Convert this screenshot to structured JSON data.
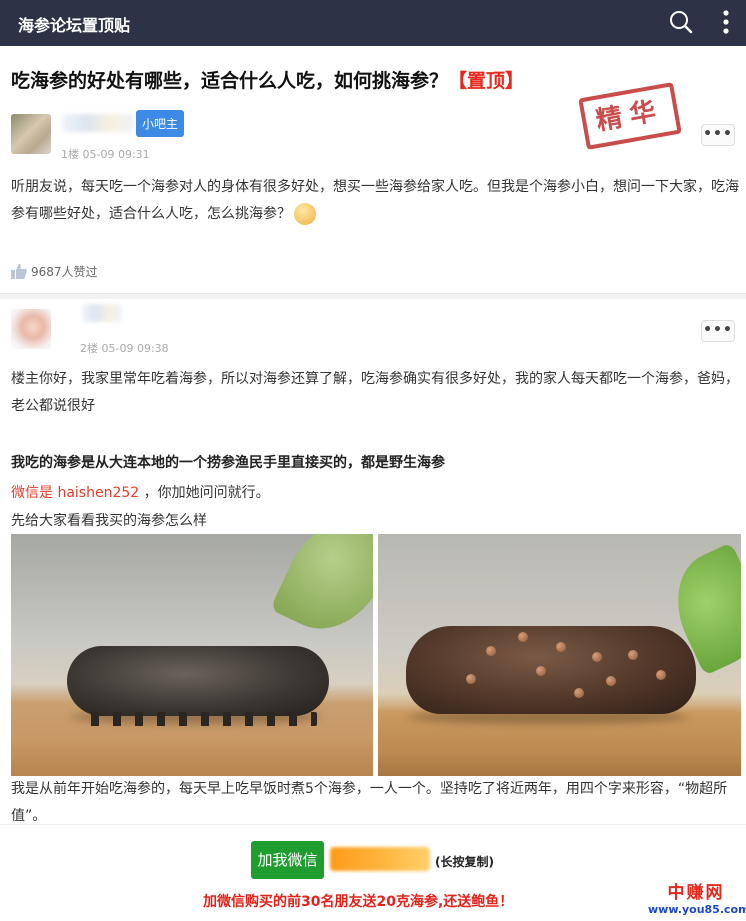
{
  "topbar": {
    "title": "海参论坛置顶贴"
  },
  "post": {
    "title": "吃海参的好处有哪些，适合什么人吃，如何挑海参？",
    "pin_label": "【置顶】",
    "stamp": "精华",
    "author_badge": "小吧主",
    "floor_meta": "1楼 05-09 09:31",
    "more_label": "•••",
    "content": "听朋友说，每天吃一个海参对人的身体有很多好处，想买一些海参给家人吃。但我是个海参小白，想问一下大家，吃海参有哪些好处，适合什么人吃，怎么挑海参？",
    "likes": "9687人赞过"
  },
  "reply": {
    "floor_meta": "2楼 05-09 09:38",
    "more_label": "•••",
    "paragraph1": "楼主你好，我家里常年吃着海参，所以对海参还算了解，吃海参确实有很多好处，我的家人每天都吃一个海参，爸妈，老公都说很好",
    "bold_line": "我吃的海参是从大连本地的一个捞参渔民手里直接买的，都是野生海参",
    "wechat_label": "微信是",
    "wechat_id": "haishen252",
    "wechat_suffix": "，你加她问问就行。",
    "look_line": "先给大家看看我买的海参怎么样",
    "paragraph2": "我是从前年开始吃海参的，每天早上吃早饭时煮5个海参，一人一个。坚持吃了将近两年，用四个字来形容，“物超所值”。"
  },
  "bottom": {
    "add_button": "加我微信",
    "longpress": "(长按复制)",
    "promo": "加微信购买的前30名朋友送20克海参,还送鲍鱼！"
  },
  "watermark": {
    "cn": "中赚网",
    "en": "www.you85.com"
  },
  "icons": {
    "search": "search-icon",
    "more": "more-vertical-icon",
    "like": "thumb-up-icon",
    "emoji": "pleading-face-emoji"
  }
}
